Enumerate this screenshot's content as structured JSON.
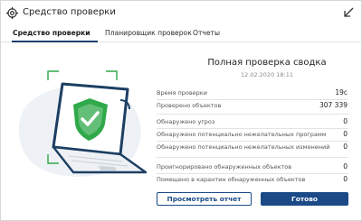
{
  "window": {
    "title": "Средство проверки",
    "icons": {
      "app": "crosshair-target-icon",
      "minimize": "arrow-down-left-icon"
    }
  },
  "tabs": [
    {
      "label": "Средство проверки",
      "active": true
    },
    {
      "label": "Планировщик проверок",
      "active": false
    },
    {
      "label": "Отчеты",
      "active": false
    }
  ],
  "illustration": {
    "icon": "laptop-shield-check-icon",
    "colors": {
      "shield": "#2fa94a",
      "laptop": "#1d3f63",
      "frame": "#2fa94a"
    }
  },
  "summary": {
    "title": "Полная проверка сводка",
    "date": "12.02.2020 18:11",
    "rows": [
      {
        "label": "Время проверки",
        "value": "19с"
      },
      {
        "label": "Проверено объектов",
        "value": "307 339"
      },
      {
        "label": "Обнаружено угроз",
        "value": "0"
      },
      {
        "label": "Обнаружено потенциально нежелательных программ",
        "value": "0"
      },
      {
        "label": "Обнаружено потенциально нежелательных изменений",
        "value": "0"
      },
      {
        "label": "Проигнорировано обнаруженных объектов",
        "value": "0"
      },
      {
        "label": "Помещено в карантин обнаруженных объектов",
        "value": "0"
      }
    ]
  },
  "buttons": {
    "report": "Просмотреть отчет",
    "done": "Готово"
  },
  "colors": {
    "accent": "#1b4a87",
    "success": "#2fa94a"
  }
}
